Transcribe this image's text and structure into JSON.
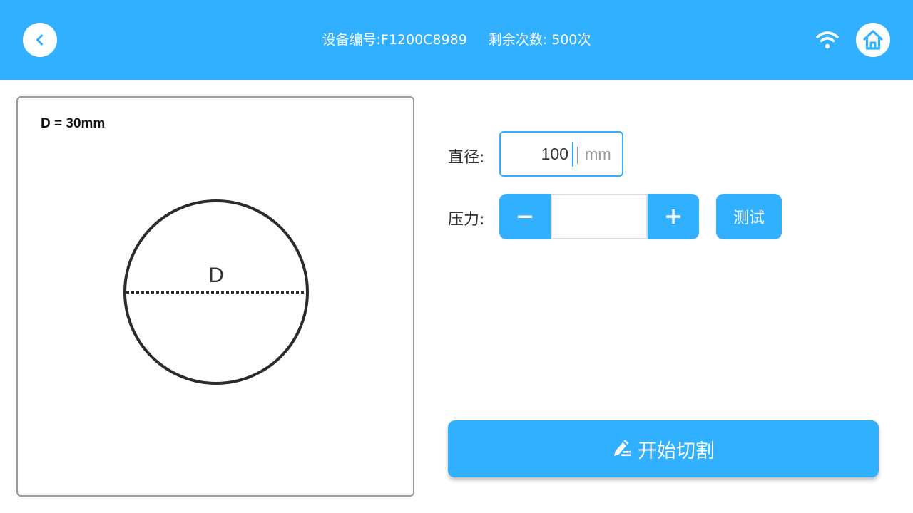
{
  "header": {
    "device_id": "设备编号:F1200C8989",
    "remaining": "剩余次数: 500次"
  },
  "preview": {
    "dimension_label": "D = 30mm",
    "diagram_letter": "D"
  },
  "form": {
    "diameter_label": "直径:",
    "diameter_value": "100",
    "diameter_unit": "mm",
    "pressure_label": "压力:",
    "pressure_value": "",
    "test_label": "测试"
  },
  "actions": {
    "start_label": "开始切割"
  },
  "colors": {
    "accent": "#30b0ff",
    "circle_stroke": "#2e2a2a"
  },
  "icons": {
    "back": "chevron-left-icon",
    "wifi": "wifi-icon",
    "home": "home-icon",
    "minus": "minus-icon",
    "plus": "plus-icon",
    "cut": "pen-edit-icon"
  }
}
